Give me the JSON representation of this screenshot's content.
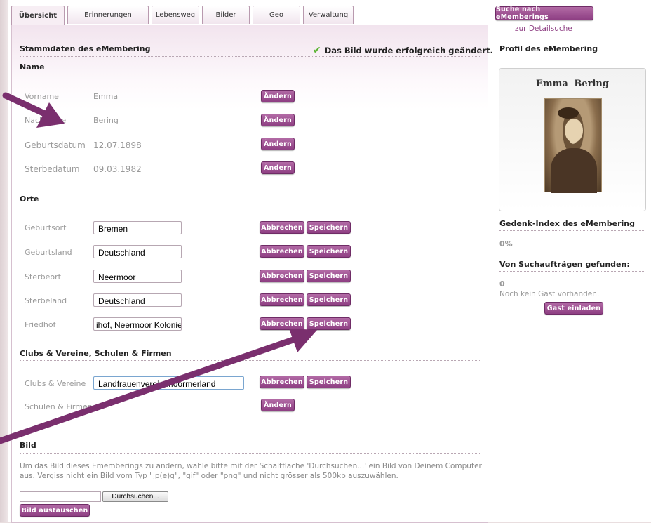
{
  "tabs": [
    "Übersicht",
    "Erinnerungen",
    "Lebensweg",
    "Bilder",
    "Geo",
    "Verwaltung"
  ],
  "main": {
    "header_title": "Stammdaten des eMembering",
    "success_message": "Das Bild wurde erfolgreich geändert.",
    "sections": {
      "name": "Name",
      "orte": "Orte",
      "clubs": "Clubs & Vereine, Schulen & Firmen",
      "bild": "Bild"
    },
    "name_fields": [
      {
        "label": "Vorname",
        "value": "Emma",
        "button": "Ändern"
      },
      {
        "label": "Nachname",
        "value": "Bering",
        "button": "Ändern"
      },
      {
        "label": "Geburtsdatum",
        "value": "12.07.1898",
        "button": "Ändern"
      },
      {
        "label": "Sterbedatum",
        "value": "09.03.1982",
        "button": "Ändern"
      }
    ],
    "orte_fields": [
      {
        "label": "Geburtsort",
        "value": "Bremen"
      },
      {
        "label": "Geburtsland",
        "value": "Deutschland"
      },
      {
        "label": "Sterbeort",
        "value": "Neermoor"
      },
      {
        "label": "Sterbeland",
        "value": "Deutschland"
      },
      {
        "label": "Friedhof",
        "value": "ihof, Neermoor Kolonie"
      }
    ],
    "clubs_fields": [
      {
        "label": "Clubs & Vereine",
        "value": "Landfrauenverein Moormerland"
      },
      {
        "label": "Schulen & Firmen",
        "button": "Ändern"
      }
    ],
    "cancel_label": "Abbrechen",
    "save_label": "Speichern",
    "bild_info": "Um das Bild dieses Ememberings zu ändern, wähle bitte mit der Schaltfläche 'Durchsuchen...' ein Bild von Deinem Computer aus. Vergiss nicht ein Bild vom Typ \"jp(e)g\", \"gif\" oder \"png\" und nicht grösser als 500kb auszuwählen.",
    "browse_label": "Durchsuchen...",
    "replace_label": "Bild austauschen"
  },
  "right": {
    "search_button": "Suche nach eMemberings",
    "detail_link": "zur Detailsuche",
    "profile_title": "Profil des eMembering",
    "profile_name": "Emma Bering",
    "index_title": "Gedenk-Index des eMembering",
    "index_value": "0%",
    "found_title": "Von Suchaufträgen gefunden:",
    "found_value": "0",
    "no_guest": "Noch kein Gast vorhanden.",
    "invite_button": "Gast einladen"
  },
  "colors": {
    "accent": "#8e3f83",
    "annotation_arrow": "#7a2f6e",
    "success_check": "#57b330"
  },
  "icons": {
    "success": "check-icon"
  }
}
